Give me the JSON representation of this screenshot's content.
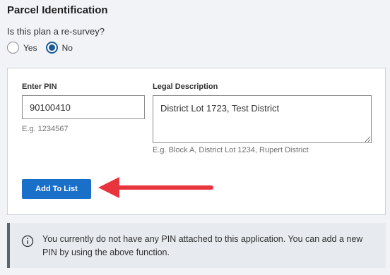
{
  "section": {
    "title": "Parcel Identification",
    "question": "Is this plan a re-survey?",
    "options": [
      {
        "label": "Yes",
        "checked": false
      },
      {
        "label": "No",
        "checked": true
      }
    ]
  },
  "form": {
    "pin_label": "Enter PIN",
    "pin_value": "90100410",
    "pin_hint": "E.g. 1234567",
    "legal_label": "Legal Description",
    "legal_value": "District Lot 1723, Test District",
    "legal_hint": "E.g. Block A, District Lot 1234, Rupert District",
    "add_button": "Add To List"
  },
  "notice": {
    "text": "You currently do not have any PIN attached to this application. You can add a new PIN by using the above function."
  },
  "colors": {
    "primary": "#1a6fc9",
    "radio": "#1a5a96",
    "arrow": "#e8343c"
  },
  "icons": {
    "notice": "info-icon",
    "callout": "arrow-left-icon"
  }
}
